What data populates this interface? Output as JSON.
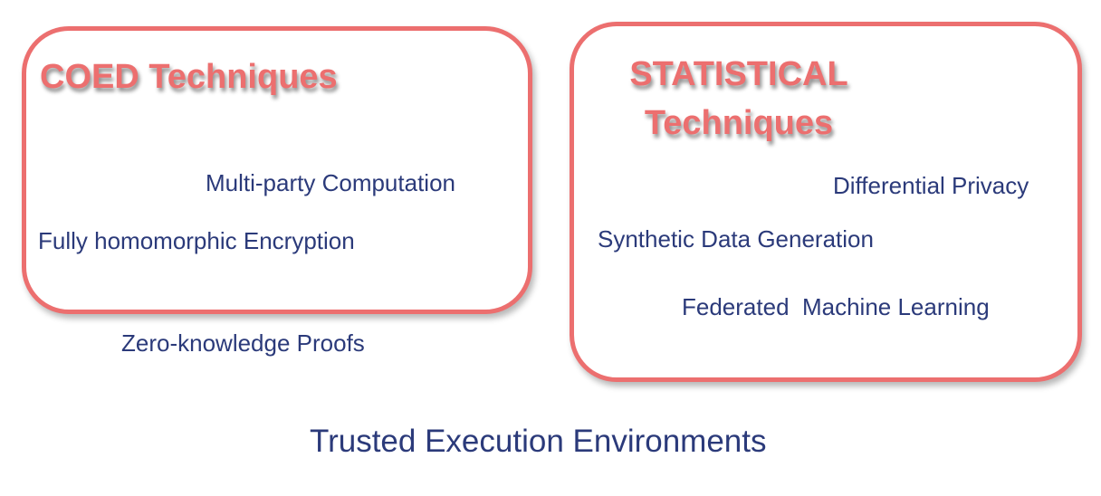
{
  "coed_group": {
    "title": "COED Techniques",
    "techniques": {
      "mpc": "Multi-party Computation",
      "fhe": "Fully homomorphic Encryption"
    }
  },
  "outside_coed": {
    "zkp": "Zero-knowledge Proofs"
  },
  "statistical_group": {
    "title_line1": "STATISTICAL",
    "title_line2": "Techniques",
    "techniques": {
      "dp": "Differential Privacy",
      "sdg": "Synthetic Data Generation",
      "fml": "Federated  Machine Learning"
    }
  },
  "bottom_label": "Trusted Execution Environments",
  "colors": {
    "accent": "#ec6f6f",
    "text": "#2b3a7a"
  }
}
